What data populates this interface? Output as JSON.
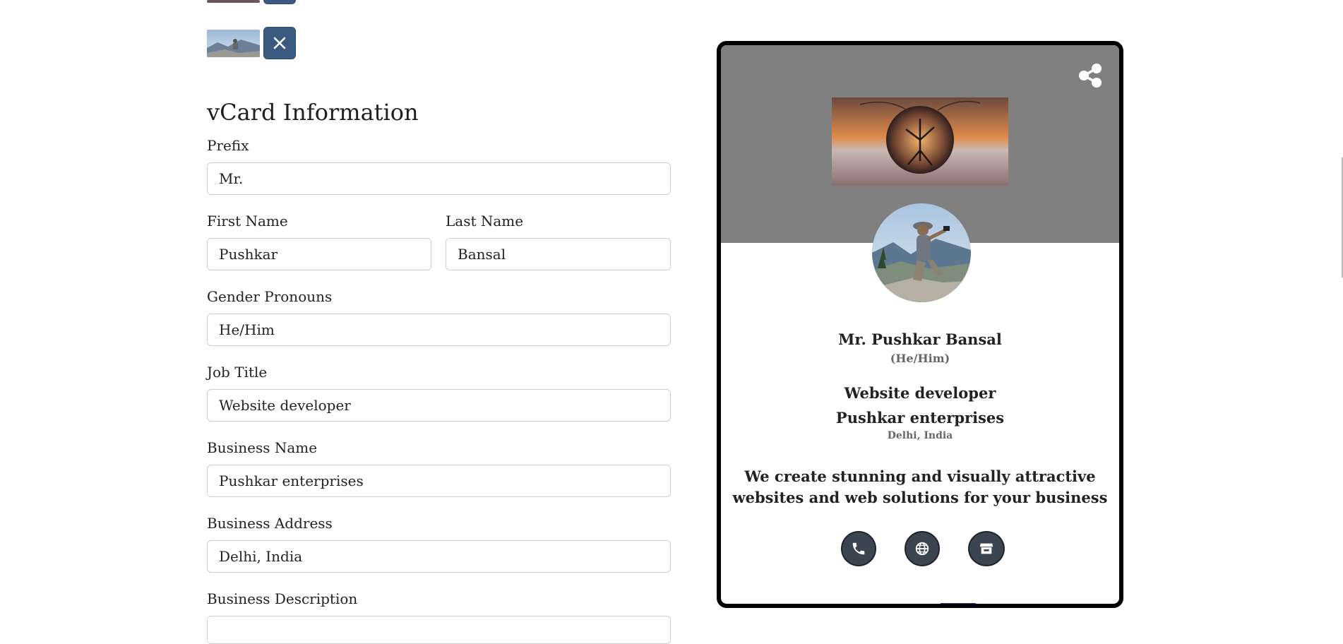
{
  "form": {
    "section_title": "vCard Information",
    "prefix": {
      "label": "Prefix",
      "value": "Mr."
    },
    "first_name": {
      "label": "First Name",
      "value": "Pushkar"
    },
    "last_name": {
      "label": "Last Name",
      "value": "Bansal"
    },
    "gender_pronouns": {
      "label": "Gender Pronouns",
      "value": "He/Him"
    },
    "job_title": {
      "label": "Job Title",
      "value": "Website developer"
    },
    "business_name": {
      "label": "Business Name",
      "value": "Pushkar enterprises"
    },
    "business_address": {
      "label": "Business Address",
      "value": "Delhi, India"
    },
    "business_description": {
      "label": "Business Description"
    }
  },
  "preview": {
    "name": "Mr. Pushkar Bansal",
    "pronouns": "(He/Him)",
    "job_title": "Website developer",
    "business_name": "Pushkar enterprises",
    "address": "Delhi, India",
    "description": "We create stunning and visually attractive websites and web solutions for your business",
    "actions": [
      "phone-icon",
      "globe-icon",
      "store-icon"
    ]
  },
  "colors": {
    "remove_button": "#3a5a80",
    "preview_header": "#808080",
    "action_button": "#3b4451"
  }
}
